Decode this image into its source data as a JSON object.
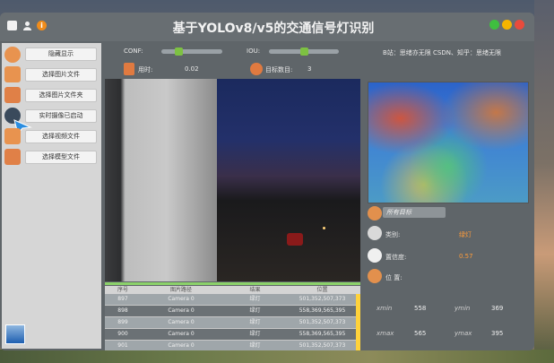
{
  "app": {
    "title": "基于YOLOv8/v5的交通信号灯识别",
    "credit": "B站：思绪亦无限 CSDN、知乎：思绪无限",
    "colors": {
      "close": "#e94b3c",
      "minimize": "#f5b400",
      "maximize": "#3fbf3f",
      "accent": "#7dc142"
    }
  },
  "sidebar": {
    "buttons": [
      {
        "label": "隐藏显示",
        "icon": "menu-icon"
      },
      {
        "label": "选择图片文件",
        "icon": "image-icon"
      },
      {
        "label": "选择图片文件夹",
        "icon": "folder-icon"
      },
      {
        "label": "实时摄像已启动",
        "icon": "camera-icon"
      },
      {
        "label": "选择视频文件",
        "icon": "video-icon"
      },
      {
        "label": "选择模型文件",
        "icon": "model-icon"
      }
    ]
  },
  "controls": {
    "conf_label": "CONF:",
    "conf_value": 0.25,
    "iou_label": "IOU:",
    "iou_value": 0.5,
    "time_label": "用时:",
    "time_value": "0.02",
    "count_label": "目标数目:",
    "count_value": "3"
  },
  "table": {
    "headers": [
      "序号",
      "图片路径",
      "结果",
      "位置"
    ],
    "rows": [
      [
        "897",
        "Camera 0",
        "绿灯",
        "501,352,507,373"
      ],
      [
        "898",
        "Camera 0",
        "绿灯",
        "558,369,565,395"
      ],
      [
        "899",
        "Camera 0",
        "绿灯",
        "501,352,507,373"
      ],
      [
        "900",
        "Camera 0",
        "绿灯",
        "558,369,565,395"
      ],
      [
        "901",
        "Camera 0",
        "绿灯",
        "501,352,507,373"
      ]
    ]
  },
  "results": {
    "target_select": "所有目标",
    "class_label": "类别:",
    "class_value": "绿灯",
    "conf_label": "置信度:",
    "conf_value": "0.57",
    "pos_label": "位 置:",
    "xmin_label": "xmin",
    "xmin_value": "558",
    "ymin_label": "ymin",
    "ymin_value": "369",
    "xmax_label": "xmax",
    "xmax_value": "565",
    "ymax_label": "ymax",
    "ymax_value": "395"
  }
}
